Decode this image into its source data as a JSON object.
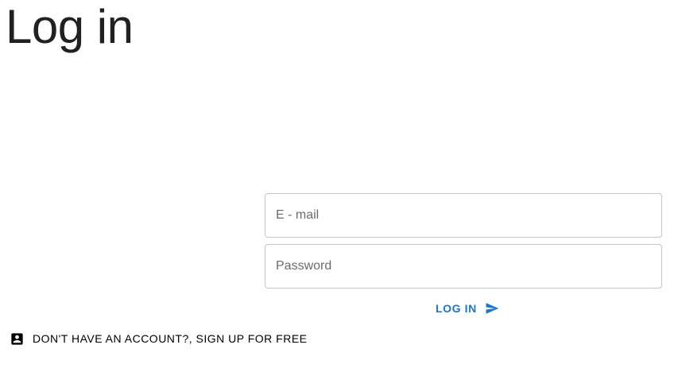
{
  "page": {
    "title": "Log in"
  },
  "form": {
    "email": {
      "placeholder": "E - mail",
      "value": ""
    },
    "password": {
      "placeholder": "Password",
      "value": ""
    },
    "login_label": "LOG IN",
    "login_icon": "send-icon"
  },
  "signup": {
    "label": "DON'T HAVE AN ACCOUNT?, SIGN UP FOR FREE",
    "icon": "account-box-icon"
  },
  "colors": {
    "accent": "#1976d2",
    "text": "#212121",
    "border": "#c4c4c4"
  }
}
